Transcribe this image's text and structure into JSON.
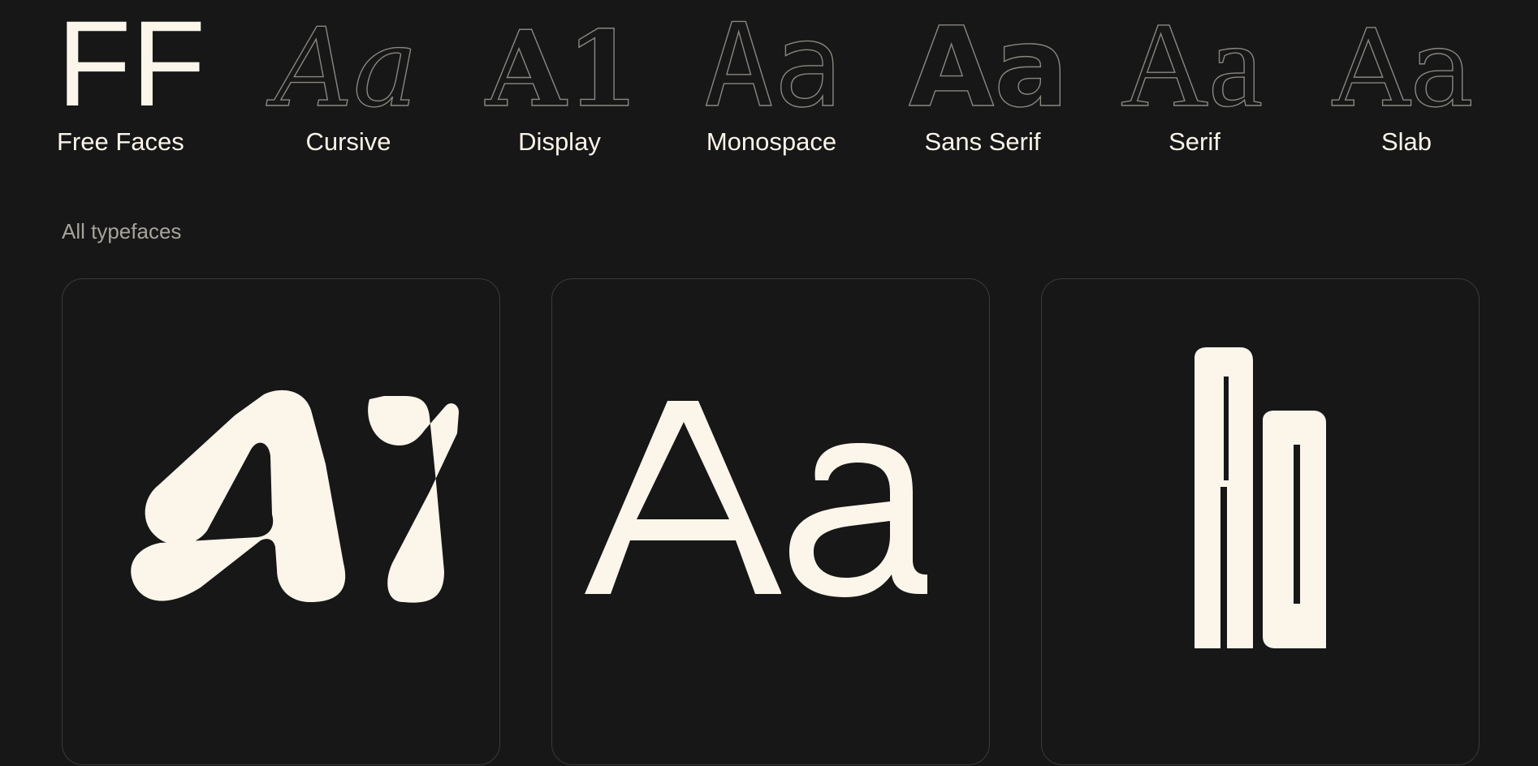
{
  "categories": [
    {
      "label": "Free Faces",
      "glyph": "FF"
    },
    {
      "label": "Cursive",
      "glyph": "Aa"
    },
    {
      "label": "Display",
      "glyph": "A1"
    },
    {
      "label": "Monospace",
      "glyph": "Aa"
    },
    {
      "label": "Sans Serif",
      "glyph": "Aa"
    },
    {
      "label": "Serif",
      "glyph": "Aa"
    },
    {
      "label": "Slab",
      "glyph": "Aa"
    }
  ],
  "section": {
    "all_label": "All typefaces"
  },
  "cards": [
    {
      "glyph": "A1"
    },
    {
      "glyph": "Aa"
    },
    {
      "glyph": "Aa"
    }
  ],
  "colors": {
    "background": "#171717",
    "foreground": "#fbf5ea",
    "muted": "#a7a39c",
    "border": "#3a3a3a"
  }
}
